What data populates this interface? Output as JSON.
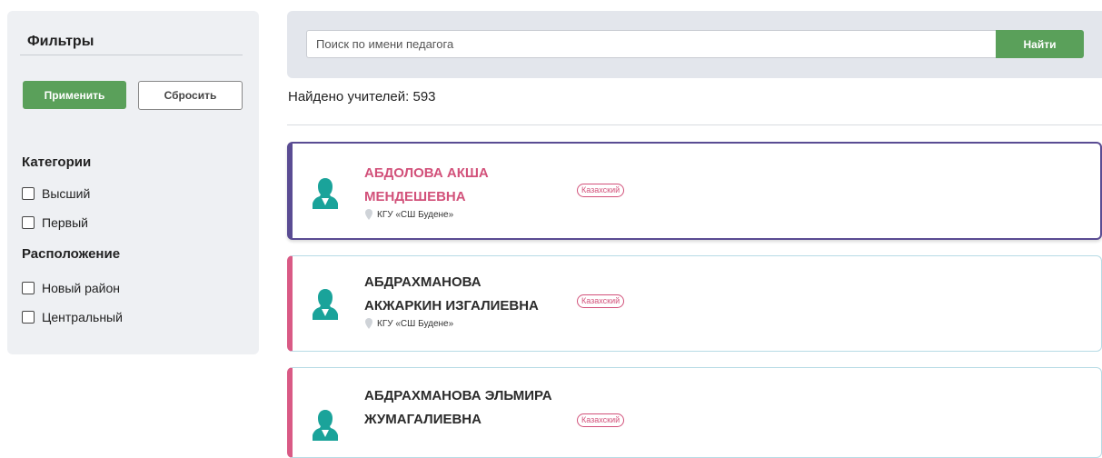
{
  "sidebar": {
    "title": "Фильтры",
    "apply_label": "Применить",
    "reset_label": "Сбросить",
    "categories_title": "Категории",
    "categories": [
      "Высший",
      "Первый"
    ],
    "location_title": "Расположение",
    "locations": [
      "Новый район",
      "Центральный"
    ]
  },
  "search": {
    "placeholder": "Поиск по имени педагога",
    "button_label": "Найти"
  },
  "results": {
    "found_text": "Найдено учителей: 593",
    "teachers": [
      {
        "name_line1": "АБДОЛОВА АКША",
        "name_line2": "МЕНДЕШЕВНА",
        "school": "КГУ «СШ Будене»",
        "language": "Казахский"
      },
      {
        "name_line1": "АБДРАХМАНОВА",
        "name_line2": "АКЖАРКИН ИЗГАЛИЕВНА",
        "school": "КГУ «СШ Будене»",
        "language": "Казахский"
      },
      {
        "name_line1": "АБДРАХМАНОВА ЭЛЬМИРА",
        "name_line2": "ЖУМАГАЛИЕВНА",
        "school": "",
        "language": "Казахский"
      }
    ]
  },
  "colors": {
    "accent_green": "#5aa05a",
    "active_border": "#5a4c93",
    "card_stripe": "#d95a85",
    "name_pink": "#d2517a",
    "avatar_teal": "#1aa39a"
  }
}
